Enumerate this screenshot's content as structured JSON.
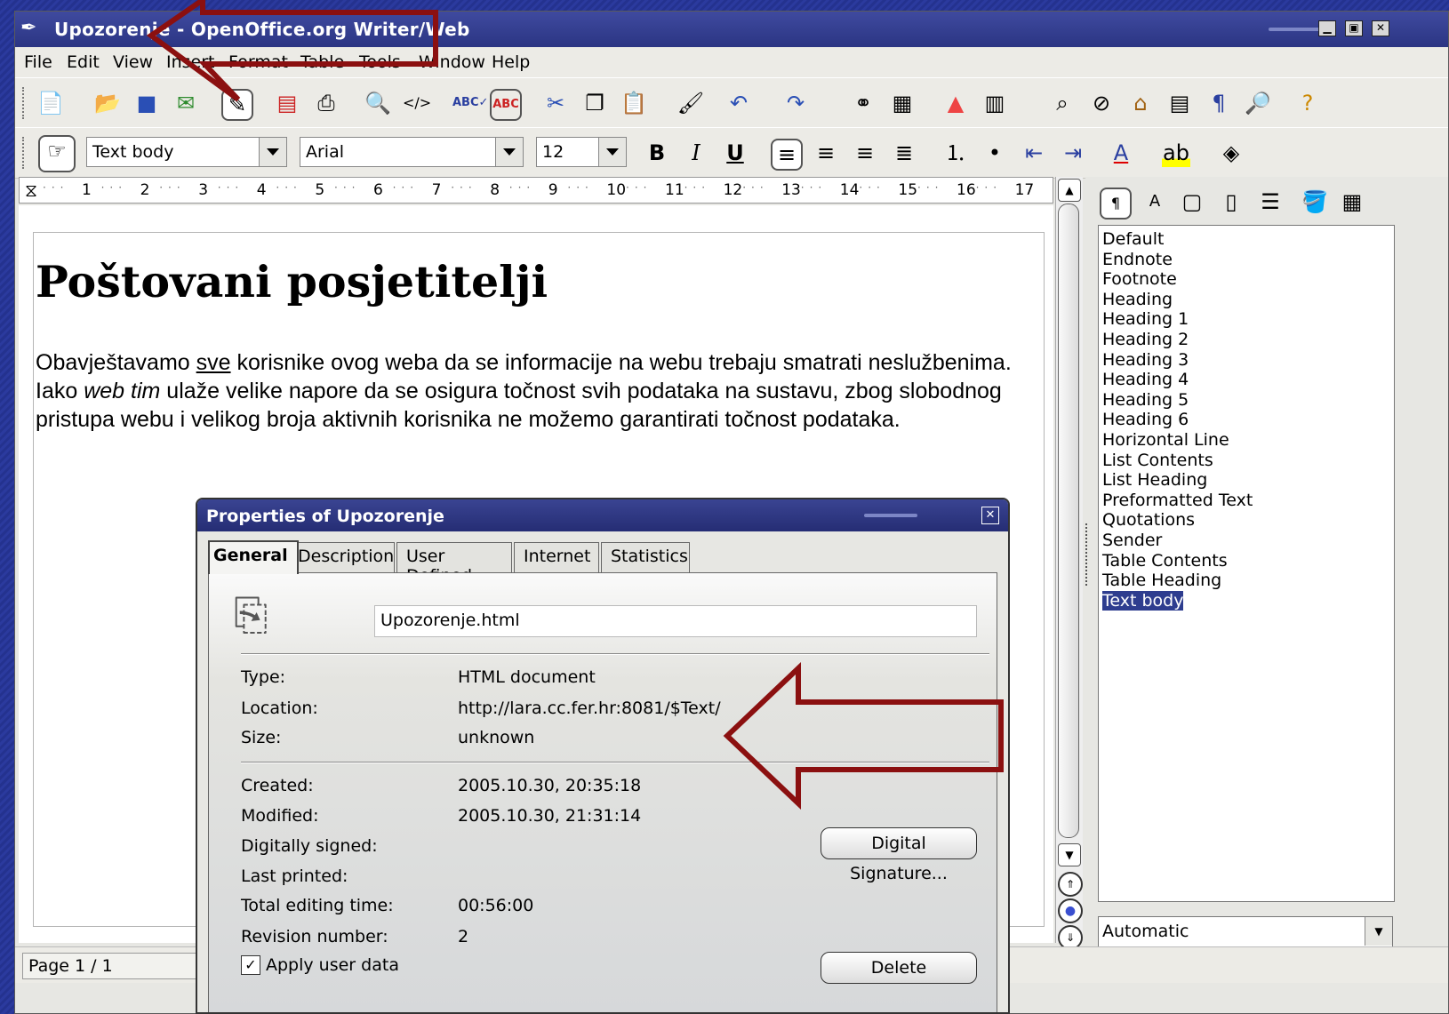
{
  "window": {
    "title": "Upozorenje - OpenOffice.org Writer/Web"
  },
  "menu": [
    "File",
    "Edit",
    "View",
    "Insert",
    "Format",
    "Table",
    "Tools",
    "Window",
    "Help"
  ],
  "format_bar": {
    "paragraph_style": "Text body",
    "font_name": "Arial",
    "font_size": "12",
    "bold": "B",
    "italic": "I",
    "underline": "U"
  },
  "ruler": {
    "marks": [
      "1",
      "2",
      "3",
      "4",
      "5",
      "6",
      "7",
      "8",
      "9",
      "10",
      "11",
      "12",
      "13",
      "14",
      "15",
      "16",
      "17"
    ]
  },
  "document": {
    "heading": "Poštovani posjetitelji",
    "p1": "Obavještavamo ",
    "p_sve": "sve",
    "p2": " korisnike ovog weba da se informacije na webu trebaju smatrati neslužbenima. Iako ",
    "p_webtim": "web tim",
    "p3": " ulaže velike napore da se osigura točnost svih podataka na sustavu, zbog slobodnog pristupa webu i velikog broja aktivnih korisnika ne možemo garantirati točnost podataka."
  },
  "styles_panel": {
    "items": [
      "Default",
      "Endnote",
      "Footnote",
      "Heading",
      "Heading 1",
      "Heading 2",
      "Heading 3",
      "Heading 4",
      "Heading 5",
      "Heading 6",
      "Horizontal Line",
      "List Contents",
      "List Heading",
      "Preformatted Text",
      "Quotations",
      "Sender",
      "Table Contents",
      "Table Heading",
      "Text body"
    ],
    "selected": "Text body",
    "filter": "Automatic"
  },
  "statusbar": {
    "page": "Page 1 / 1"
  },
  "dialog": {
    "title": "Properties of Upozorenje",
    "tabs": [
      "General",
      "Description",
      "User Defined",
      "Internet",
      "Statistics"
    ],
    "active_tab": "General",
    "filename": "Upozorenje.html",
    "labels": {
      "type": "Type:",
      "location": "Location:",
      "size": "Size:",
      "created": "Created:",
      "modified": "Modified:",
      "signed": "Digitally signed:",
      "printed": "Last printed:",
      "editing": "Total editing time:",
      "revision": "Revision number:"
    },
    "values": {
      "type": "HTML document",
      "location": "http://lara.cc.fer.hr:8081/$Text/",
      "size": "unknown",
      "created": "2005.10.30, 20:35:18",
      "modified": "2005.10.30, 21:31:14",
      "signed": "",
      "printed": "",
      "editing": "00:56:00",
      "revision": "2"
    },
    "digital_signature_button": "Digital Signature...",
    "apply_user_data": "Apply user data",
    "delete_button": "Delete"
  },
  "colors": {
    "annotation_arrow": "#8b1010",
    "titlebar": "#2e3888",
    "selection": "#2e3d8f"
  }
}
